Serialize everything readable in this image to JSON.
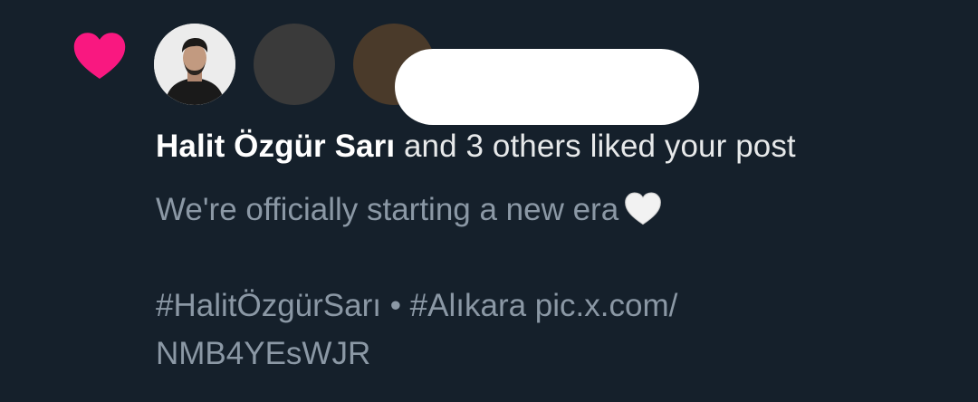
{
  "notification": {
    "type_icon": "heart-icon",
    "heart_color": "#f91880",
    "liker_name": "Halit Özgür Sarı",
    "liker_suffix": " and 3 others liked your post",
    "post": {
      "line1": "We're officially starting a new era",
      "line1_emoji": "white-heart",
      "line3": "#HalitÖzgürSarı • #Alıkara pic.x.com/",
      "line4": "NMB4YEsWJR"
    }
  },
  "colors": {
    "background": "#15202b",
    "primary_text": "#e7e9ea",
    "secondary_text": "#8b98a5"
  }
}
